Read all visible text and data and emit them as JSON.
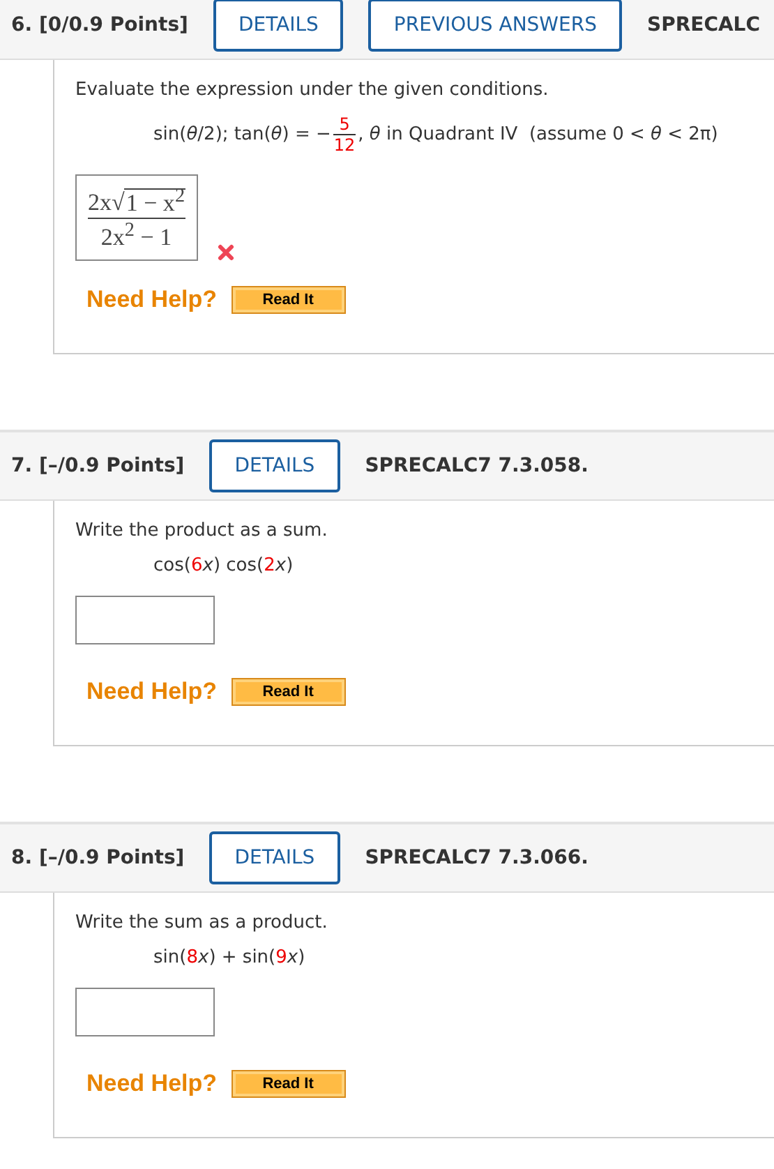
{
  "questions": [
    {
      "number": "6.",
      "points": "[0/0.9 Points]",
      "buttons": [
        "DETAILS",
        "PREVIOUS ANSWERS"
      ],
      "code": "SPRECALC",
      "header_cut": true,
      "prompt": "Evaluate the expression under the given conditions.",
      "expression": [
        {
          "kind": "text",
          "text": "sin(*θ*/2); tan(*θ*) = −"
        },
        {
          "kind": "fraction",
          "numerator": "5",
          "denominator": "12",
          "highlight": true
        },
        {
          "kind": "text",
          "text": ", *θ* in Quadrant IV  (assume 0 < *θ* < 2π)"
        }
      ],
      "answer": {
        "kind": "fraction",
        "lead": "2x",
        "radical": "√",
        "radicand": "1 − x$^{2}$",
        "denominator": "2x$^{2}$ − 1",
        "correct": false
      },
      "help": "Need Help?",
      "help_button": "Read It"
    },
    {
      "number": "7.",
      "points": "[–/0.9 Points]",
      "buttons": [
        "DETAILS"
      ],
      "code": "SPRECALC7 7.3.058.",
      "header_cut": false,
      "prompt": "Write the product as a sum.",
      "expression": [
        {
          "kind": "text",
          "text": "cos("
        },
        {
          "kind": "number",
          "text": "6",
          "highlight": true
        },
        {
          "kind": "text",
          "text": "*x*) cos("
        },
        {
          "kind": "number",
          "text": "2",
          "highlight": true
        },
        {
          "kind": "text",
          "text": "*x*)"
        }
      ],
      "answer": {
        "kind": "empty"
      },
      "help": "Need Help?",
      "help_button": "Read It"
    },
    {
      "number": "8.",
      "points": "[–/0.9 Points]",
      "buttons": [
        "DETAILS"
      ],
      "code": "SPRECALC7 7.3.066.",
      "header_cut": false,
      "prompt": "Write the sum as a product.",
      "expression": [
        {
          "kind": "text",
          "text": "sin("
        },
        {
          "kind": "number",
          "text": "8",
          "highlight": true
        },
        {
          "kind": "text",
          "text": "*x*) + sin("
        },
        {
          "kind": "number",
          "text": "9",
          "highlight": true
        },
        {
          "kind": "text",
          "text": "*x*)"
        }
      ],
      "answer": {
        "kind": "empty"
      },
      "help": "Need Help?",
      "help_button": "Read It"
    }
  ]
}
